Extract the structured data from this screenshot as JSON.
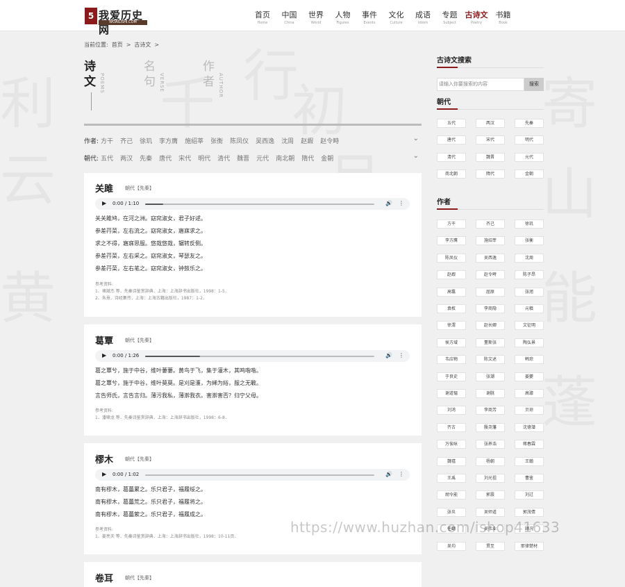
{
  "logo": {
    "mark": "5",
    "text": "我爱历史网",
    "sub": "WOAILISHI.COM"
  },
  "nav": [
    {
      "cn": "首页",
      "en": "Home"
    },
    {
      "cn": "中国",
      "en": "China"
    },
    {
      "cn": "世界",
      "en": "World"
    },
    {
      "cn": "人物",
      "en": "Figures"
    },
    {
      "cn": "事件",
      "en": "Events"
    },
    {
      "cn": "文化",
      "en": "Culture"
    },
    {
      "cn": "成语",
      "en": "Idiom"
    },
    {
      "cn": "专题",
      "en": "Subject"
    },
    {
      "cn": "古诗文",
      "en": "Poetry",
      "active": true
    },
    {
      "cn": "书籍",
      "en": "Book"
    }
  ],
  "breadcrumb": {
    "label": "当前位置:",
    "home": "首页",
    "sep": ">",
    "current": "古诗文"
  },
  "tabs": [
    {
      "cn1": "诗",
      "cn2": "文",
      "en": "POEMS"
    },
    {
      "cn1": "名",
      "cn2": "句",
      "en": "VERSE"
    },
    {
      "cn1": "作",
      "cn2": "者",
      "en": "AUTHOR"
    }
  ],
  "filters": {
    "authors_label": "作者:",
    "authors": [
      "方干",
      "齐己",
      "徐玑",
      "李方膺",
      "施绍莘",
      "张衡",
      "陈凤仪",
      "吴西逸",
      "沈周",
      "赵嘏",
      "赵令畤"
    ],
    "dynasty_label": "朝代:",
    "dynasties": [
      "五代",
      "两汉",
      "先秦",
      "唐代",
      "宋代",
      "明代",
      "清代",
      "魏晋",
      "元代",
      "南北朝",
      "隋代",
      "金朝"
    ],
    "chevron": "⌄"
  },
  "poems": [
    {
      "title": "关雎",
      "meta": "朝代【先秦】",
      "audio": {
        "time": "0:00 / 1:10",
        "progress": 0.08
      },
      "lines": [
        "关关雎鸠，在河之洲。窈窕淑女，君子好逑。",
        "参差荇菜，左右流之。窈窕淑女，寤寐求之。",
        "求之不得，寤寐思服。悠哉悠哉，辗转反侧。",
        "参差荇菜，左右采之。窈窕淑女，琴瑟友之。",
        "参差荇菜，左右芼之。窈窕淑女，钟鼓乐之。"
      ],
      "ref_label": "参考资料:",
      "refs": [
        "1、褚斌杰 等．先秦诗鉴赏辞典．上海：上海辞书出版社，1998：1-5．",
        "2、朱熹．诗经集传．上海：上海古籍出版社，1987：1-2．"
      ]
    },
    {
      "title": "葛覃",
      "meta": "朝代【先秦】",
      "audio": {
        "time": "0:00 / 1:26",
        "progress": 0.24
      },
      "lines": [
        "葛之覃兮，施于中谷，维叶萋萋。黄鸟于飞，集于灌木，其鸣喈喈。",
        "葛之覃兮，施于中谷，维叶莫莫。是刈是濩，为絺为綌，服之无斁。",
        "言告师氏，言告言归。薄污我私，薄澣我衣。害澣害否？归宁父母。"
      ],
      "ref_label": "参考资料:",
      "refs": [
        "1、潘啸龙 等．先秦诗鉴赏辞典．上海：上海辞书出版社，1998：6-8．"
      ]
    },
    {
      "title": "樛木",
      "meta": "朝代【先秦】",
      "audio": {
        "time": "0:00 / 1:02",
        "progress": 0.0
      },
      "lines": [
        "南有樛木，葛藟累之。乐只君子，福履绥之。",
        "南有樛木，葛藟荒之。乐只君子，福履将之。",
        "南有樛木，葛藟萦之。乐只君子，福履成之。"
      ],
      "ref_label": "参考资料:",
      "refs": [
        "1、姜亮夫 等．先秦诗鉴赏辞典．上海：上海辞书出版社，1998：10-11页．"
      ]
    },
    {
      "title": "卷耳",
      "meta": "朝代【先秦】"
    }
  ],
  "sidebar": {
    "search_title": "古诗文搜索",
    "search_placeholder": "请输入你要搜索的内容",
    "search_button": "搜索",
    "dynasty_title": "朝代",
    "dynasties": [
      "五代",
      "两汉",
      "先秦",
      "唐代",
      "宋代",
      "明代",
      "清代",
      "魏晋",
      "元代",
      "南北朝",
      "隋代",
      "金朝"
    ],
    "author_title": "作者",
    "authors": [
      "方干",
      "齐己",
      "徐玑",
      "李方膺",
      "施绍莘",
      "张衡",
      "陈凤仪",
      "吴西逸",
      "沈周",
      "赵嘏",
      "赵令畤",
      "陈子昂",
      "高翥",
      "屈原",
      "张旭",
      "袁枚",
      "李商隐",
      "元稹",
      "徐渭",
      "赵长卿",
      "文征明",
      "侯方域",
      "董斯张",
      "陶弘景",
      "韦应物",
      "陈文述",
      "韩琮",
      "于良史",
      "张潮",
      "姜夔",
      "谢道韫",
      "谢朓",
      "高璩",
      "刘鸿",
      "李商芳",
      "贝琼",
      "齐古",
      "殷尧藩",
      "沈德潜",
      "万俟咏",
      "张养浩",
      "蒋春霖",
      "魏禧",
      "杨朝",
      "王翰",
      "王禹",
      "刘光祖",
      "曹鉴",
      "胡令能",
      "郭震",
      "刘过",
      "张炎",
      "吴师道",
      "郭茂倩",
      "任翻",
      "吴伟业",
      "顾况",
      "吴均",
      "贯至",
      "耶律楚材"
    ]
  },
  "watermark": "https://www.huzhan.com/ishop41633"
}
